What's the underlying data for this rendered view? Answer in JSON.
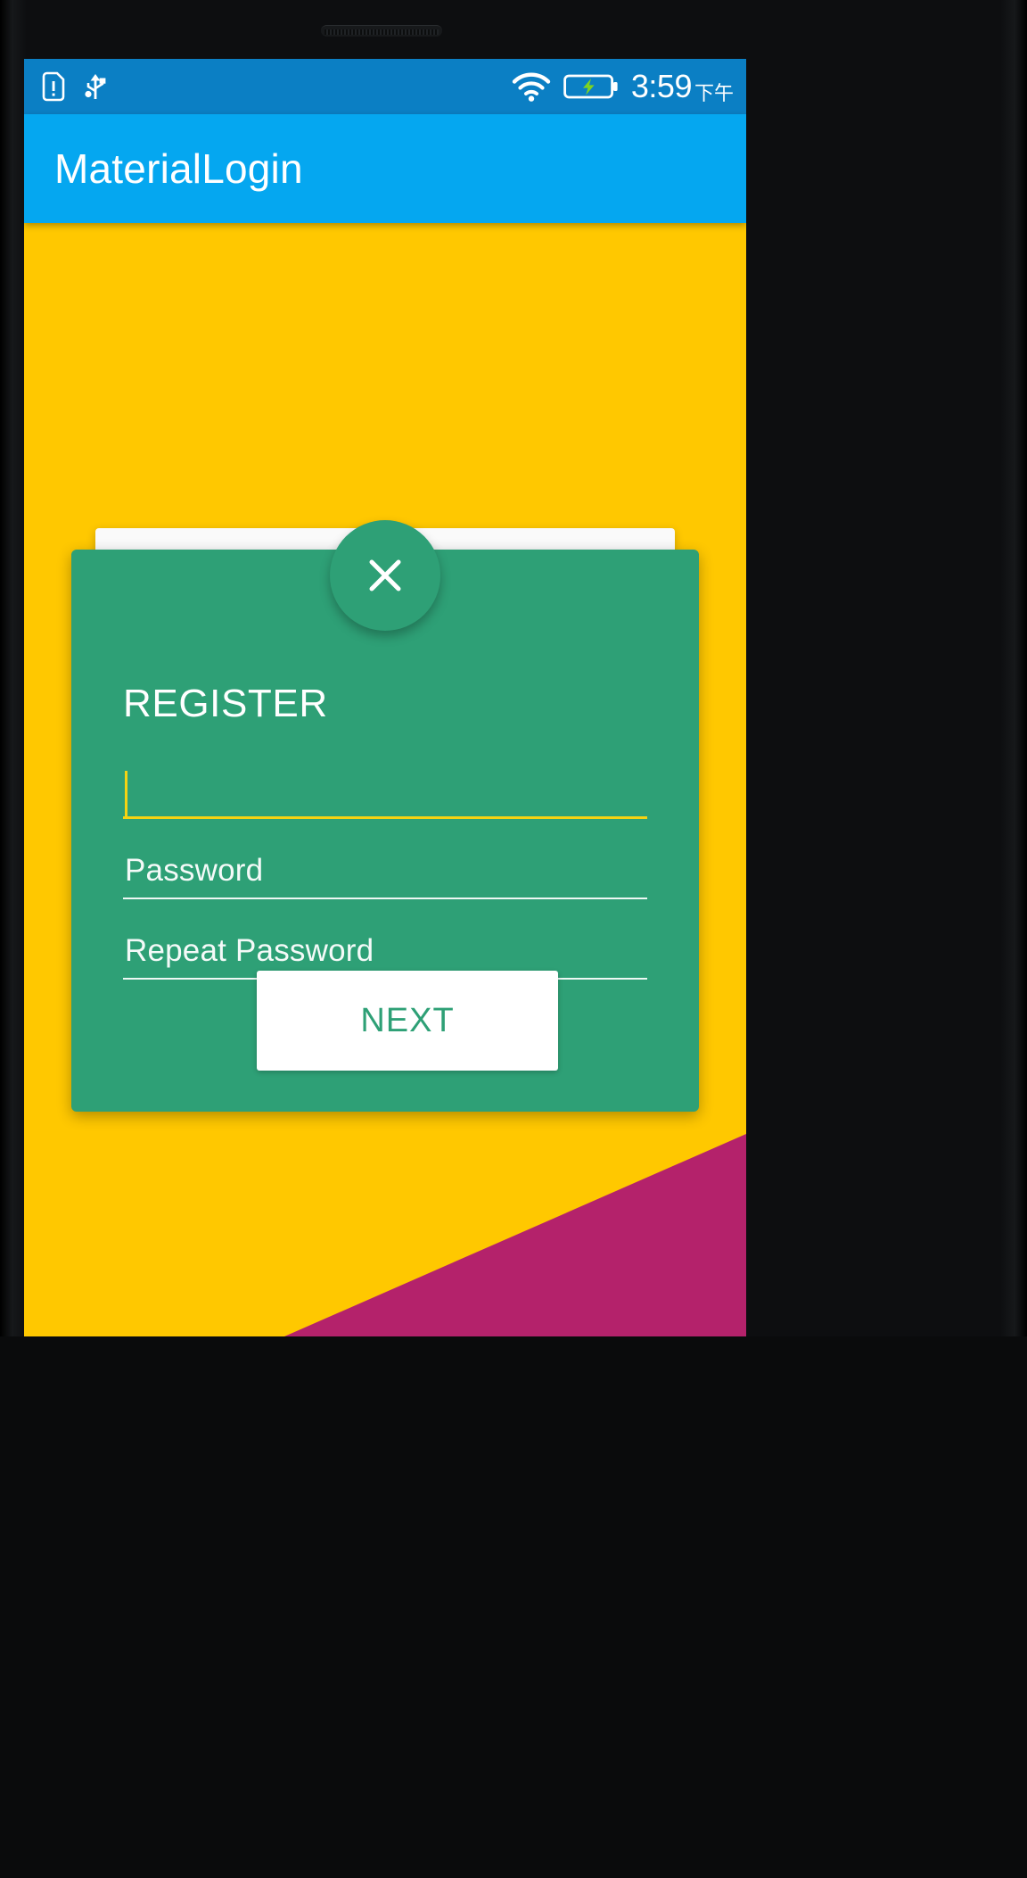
{
  "device": {
    "speaker_name": "earpiece-speaker-grille"
  },
  "status_bar": {
    "background_color": "#0b7fc4",
    "icons": [
      {
        "name": "sim-alert-icon",
        "label": "SIM alert"
      },
      {
        "name": "usb-icon",
        "label": "USB connected"
      },
      {
        "name": "wifi-icon",
        "label": "Wi-Fi signal"
      },
      {
        "name": "battery-charging-icon",
        "label": "Battery charging"
      }
    ],
    "time": "3:59",
    "am_pm": "下午"
  },
  "app_bar": {
    "title": "MaterialLogin",
    "background_color": "#05a7f0",
    "text_color": "#ffffff"
  },
  "background": {
    "primary_color": "#ffc800",
    "accent_shape_color": "#b4226b",
    "accent_shape_name": "diagonal-triangle"
  },
  "login_card": {
    "background_color": "#fafafa"
  },
  "register_panel": {
    "background_color": "#2ea076",
    "title": "REGISTER",
    "close_button": {
      "name": "close-button",
      "icon": "close-icon",
      "glyph": "×",
      "background_color": "#2ea076"
    },
    "fields": [
      {
        "name": "username-field",
        "label": "",
        "value": "",
        "placeholder": "",
        "focused": true,
        "underline_color": "#f5d312"
      },
      {
        "name": "password-field",
        "label": "Password",
        "value": "",
        "placeholder": "Password",
        "focused": false,
        "underline_color": "#ffffff"
      },
      {
        "name": "repeat-password-field",
        "label": "Repeat Password",
        "value": "",
        "placeholder": "Repeat Password",
        "focused": false,
        "underline_color": "#ffffff"
      }
    ],
    "submit_button": {
      "label": "NEXT",
      "background_color": "#ffffff",
      "text_color": "#2ea076"
    }
  }
}
